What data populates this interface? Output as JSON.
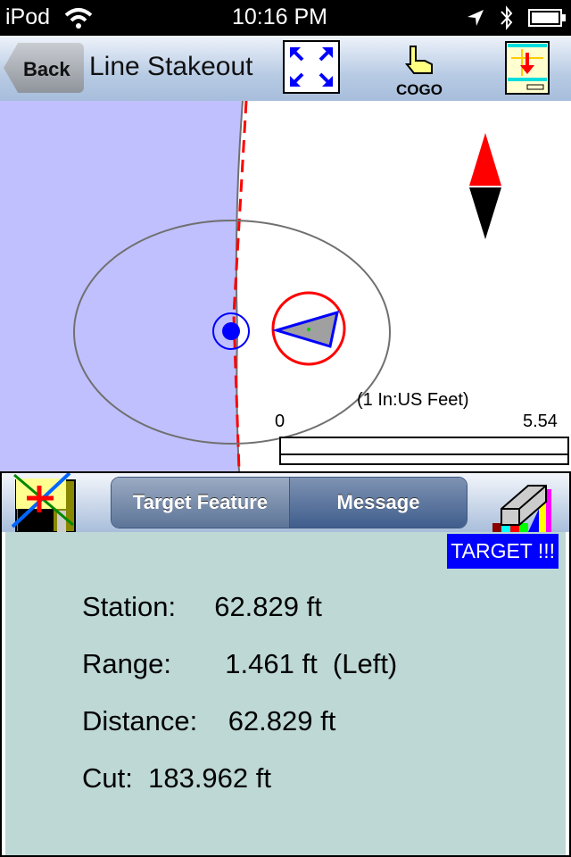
{
  "status": {
    "carrier": "iPod",
    "time": "10:16 PM"
  },
  "nav": {
    "back": "Back",
    "title": "Line Stakeout",
    "cogo": "COGO"
  },
  "map": {
    "scale_caption": "(1 In:US Feet)",
    "scale_start": "0",
    "scale_end": "5.54",
    "colors": {
      "offside": "#c0c0ff",
      "line": "#ff0000",
      "target": "#0000ff"
    }
  },
  "toolbar": {
    "tabs": [
      "Target Feature",
      "Message"
    ]
  },
  "info": {
    "badge": "TARGET !!!",
    "station_label": "Station:",
    "station": "62.829 ft",
    "range_label": "Range:",
    "range": "1.461 ft  (Left)",
    "distance_label": "Distance:",
    "distance": "62.829 ft",
    "cut_label": "Cut:",
    "cut": "183.962 ft"
  }
}
